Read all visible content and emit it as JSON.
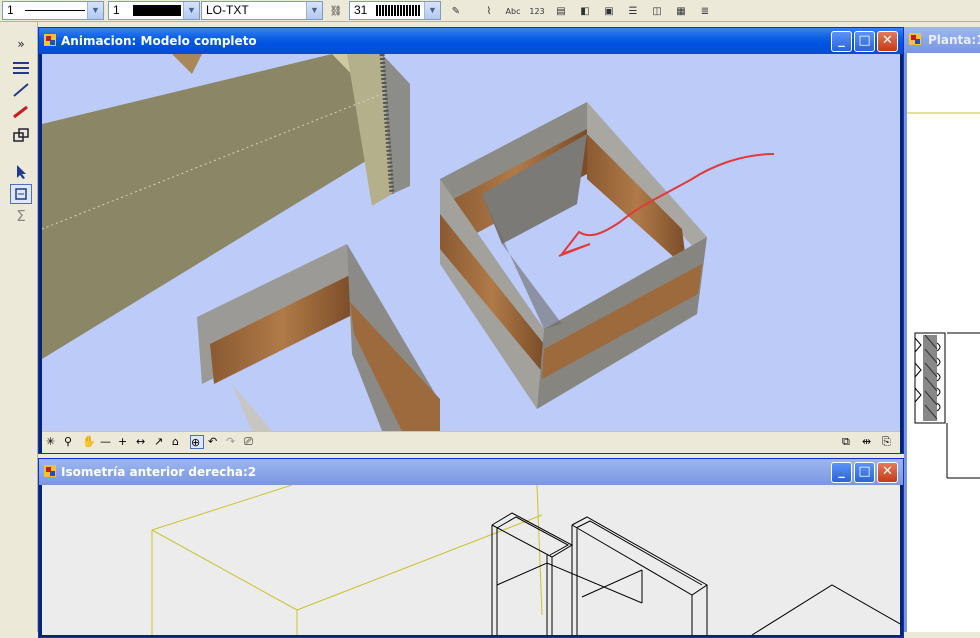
{
  "toolbar": {
    "pen_value": "1",
    "color_value": "1",
    "layer_value": "LO-TXT",
    "hatch_value": "31"
  },
  "windows": {
    "animation": {
      "title": "Animacion: Modelo completo"
    },
    "isometric": {
      "title": "Isometría anterior derecha:2"
    },
    "plan": {
      "title": "Planta:1"
    }
  },
  "colors": {
    "viewport_bg": "#bccbf8",
    "iso_bg": "#ececec",
    "title_active": "#0054e3",
    "sketch_line": "#e03a3a"
  }
}
